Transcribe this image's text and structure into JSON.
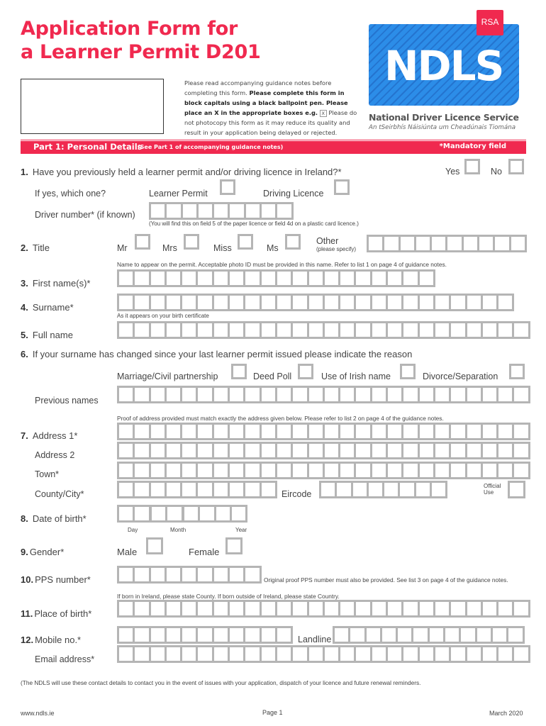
{
  "header": {
    "title_line1": "Application Form for",
    "title_line2": "a Learner Permit D201",
    "instructions": {
      "part1": "Please read accompanying guidance notes before completing this form. ",
      "bold": "Please complete this form in block capitals using a black ballpoint pen. Please place an X in the appropriate boxes e.g.",
      "example_mark": "x",
      "part2": " Please do not photocopy this form as it may reduce its quality and result in your application being delayed or rejected."
    },
    "logo": {
      "rsa": "RSA",
      "ndls": "NDLS",
      "name": "National Driver Licence Service",
      "irish_name": "An tSeirbhís Náisiúnta um Cheadúnais Tiomána"
    },
    "colors": {
      "accent": "#f0294f",
      "logo_blue": "#2c8de8",
      "box_border": "#b5b5b5"
    }
  },
  "section": {
    "title": "Part 1: Personal Details",
    "subtitle": "(See Part 1 of accompanying guidance notes)",
    "mandatory": "*Mandatory field"
  },
  "questions": {
    "q1": {
      "num": "1.",
      "text": "Have you previously held a learner permit and/or driving licence in Ireland?*",
      "yes": "Yes",
      "no": "No",
      "which_label": "If yes, which one?",
      "learner": "Learner Permit",
      "driving": "Driving Licence",
      "driver_no_label": "Driver number* (if known)",
      "driver_no_boxes": 9,
      "driver_no_note": "(You will find this on field 5 of the paper licence or field 4d on a plastic card licence.)"
    },
    "q2": {
      "num": "2.",
      "label": "Title",
      "options": [
        "Mr",
        "Mrs",
        "Miss",
        "Ms"
      ],
      "other": "Other",
      "other_sub": "(please specify)",
      "other_boxes": 10,
      "note": "Name to appear on the permit. Acceptable photo ID must be provided in this name. Refer to list 1 on page 4 of guidance notes."
    },
    "q3": {
      "num": "3.",
      "label": "First name(s)*",
      "boxes": 20
    },
    "q4": {
      "num": "4.",
      "label": "Surname*",
      "boxes": 25,
      "note": "As it appears on your birth certificate"
    },
    "q5": {
      "num": "5.",
      "label": "Full name",
      "boxes": 26
    },
    "q6": {
      "num": "6.",
      "text": "If your surname has changed since your last learner permit issued please indicate the reason",
      "options": [
        "Marriage/Civil partnership",
        "Deed Poll",
        "Use of Irish name",
        "Divorce/Separation"
      ],
      "prev_label": "Previous names",
      "prev_boxes": 26,
      "note": "Proof of address provided must match exactly the address given below. Please refer to list 2 on page 4 of the guidance notes."
    },
    "q7": {
      "num": "7.",
      "address1": "Address 1*",
      "address2": "Address 2",
      "town": "Town*",
      "county": "County/City*",
      "eircode": "Eircode",
      "official1": "Official",
      "official2": "Use",
      "line_boxes": 26,
      "county_boxes": 10,
      "eircode_boxes": 8
    },
    "q8": {
      "num": "8.",
      "label": "Date of birth*",
      "day": "Day",
      "month": "Month",
      "year": "Year"
    },
    "q9": {
      "num": "9.",
      "label": "Gender*",
      "male": "Male",
      "female": "Female"
    },
    "q10": {
      "num": "10.",
      "label": "PPS number*",
      "boxes": 9,
      "note": "Original proof PPS number must also be provided. See list 3 on page 4 of the guidance notes."
    },
    "q11": {
      "num": "11.",
      "label": "Place of birth*",
      "boxes": 26,
      "note": "If born in Ireland, please state County. If born outside of Ireland, please state Country."
    },
    "q12": {
      "num": "12.",
      "label": "Mobile no.*",
      "mobile_boxes": 11,
      "landline": "Landline",
      "landline_boxes": 12,
      "email": "Email address*",
      "email_boxes": 26
    }
  },
  "contact_note": "(The NDLS will use these contact details to contact you in the event of issues with your application, dispatch of your licence and future renewal reminders.",
  "footer": {
    "website": "www.ndls.ie",
    "page": "Page 1",
    "date": "March 2020"
  }
}
